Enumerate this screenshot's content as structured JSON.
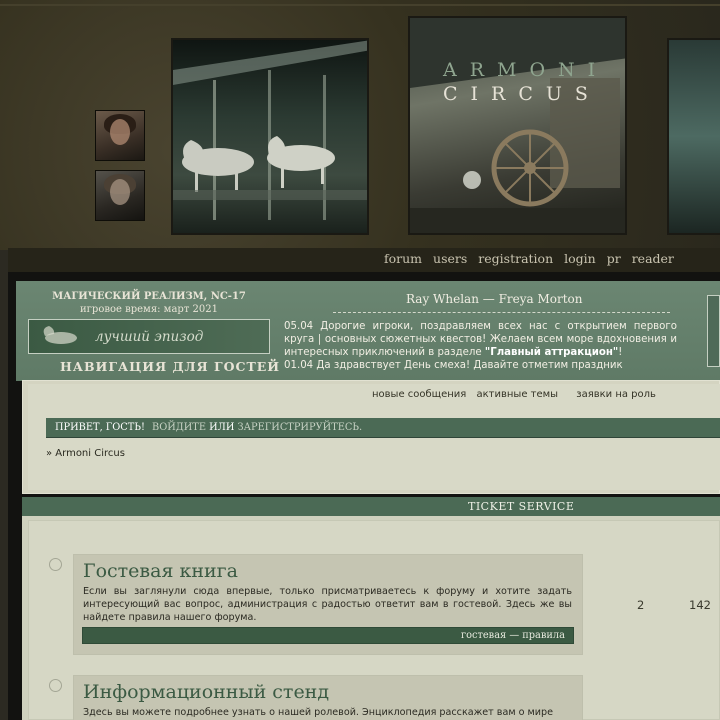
{
  "header": {
    "logo_line1": "ARMONI",
    "logo_line2": "CIRCUS"
  },
  "nav": {
    "items": [
      "forum",
      "users",
      "registration",
      "login",
      "pr",
      "reader"
    ]
  },
  "stats": {
    "genre": "МАГИЧЕСКИЙ РЕАЛИЗМ, NC-17",
    "game_time": "игровое время: март 2021",
    "best_episode": "лучший эпизод",
    "guest_nav": "НАВИГАЦИЯ ДЛЯ ГОСТЕЙ",
    "couple": "Ray Whelan — Freya Morton",
    "announce_1_date": "05.04",
    "announce_1_text": "Дорогие игроки, поздравляем всех нас с открытием первого круга | основных сюжетных квестов! Желаем всем море вдохновения и интересных приключений в разделе",
    "announce_1_link": "\"Главный аттракцион\"",
    "announce_1_end": "!",
    "announce_2_date": "01.04",
    "announce_2_text": "Да здравствует День смеха! Давайте отметим праздник"
  },
  "quicklinks": [
    "новые сообщения",
    "активные темы",
    "заявки на роль"
  ],
  "greeting": {
    "hello": "ПРИВЕТ, ГОСТЬ!",
    "login": "ВОЙДИТЕ",
    "or": "ИЛИ",
    "register": "ЗАРЕГИСТРИРУЙТЕСЬ."
  },
  "breadcrumb": "» Armoni Circus",
  "category": "TICKET SERVICE",
  "forums": [
    {
      "title": "Гостевая книга",
      "desc": "Если вы заглянули сюда впервые, только присматриваетесь к форуму и хотите задать интересующий вас вопрос, администрация с радостью ответит вам в гостевой. Здесь же вы найдете правила нашего форума.",
      "sublinks": "гостевая — правила",
      "topics": "2",
      "posts": "142"
    },
    {
      "title": "Информационный стенд",
      "desc": "Здесь вы можете подробнее узнать о нашей ролевой. Энциклопедия расскажет вам о мире"
    }
  ]
}
